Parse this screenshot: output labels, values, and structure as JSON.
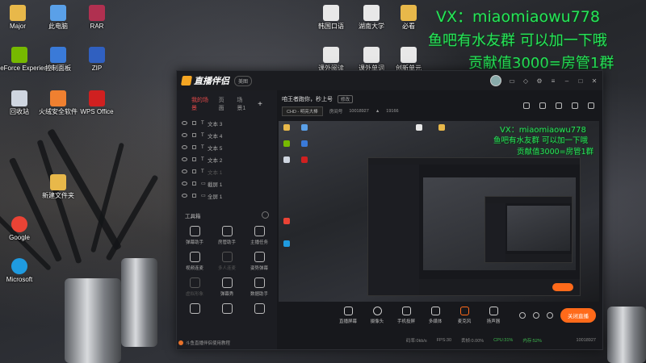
{
  "desktop": {
    "icons": [
      {
        "label": "Major",
        "color": "#e8b84a"
      },
      {
        "label": "此电脑",
        "color": "#5aa0e8"
      },
      {
        "label": "RAR",
        "color": "#b03050"
      },
      {
        "label": "GeForce Experience",
        "color": "#76b900"
      },
      {
        "label": "控制面板",
        "color": "#3a7ad8"
      },
      {
        "label": "ZIP",
        "color": "#3060c0"
      },
      {
        "label": "回收站",
        "color": "#cfd6e0"
      },
      {
        "label": "火绒安全软件",
        "color": "#f08030"
      },
      {
        "label": "WPS Office",
        "color": "#d02020"
      },
      {
        "label": "新建文件夹",
        "color": "#e8b84a"
      },
      {
        "label": "Google",
        "color": "#ea4335"
      },
      {
        "label": "Microsoft",
        "color": "#1f9be0"
      },
      {
        "label": "韩国口语",
        "color": "#e8e8e8"
      },
      {
        "label": "湖南大学",
        "color": "#e8e8e8"
      },
      {
        "label": "必看",
        "color": "#e8b84a"
      },
      {
        "label": "课外阅读",
        "color": "#e8e8e8"
      },
      {
        "label": "课外单词",
        "color": "#e8e8e8"
      },
      {
        "label": "创新单元",
        "color": "#e8e8e8"
      }
    ],
    "overlay_lines": [
      "VX：miaomiaowu778",
      "鱼吧有水友群 可以加一下哦",
      "贡献值3000=房管1群"
    ]
  },
  "app": {
    "name": "直播伴侣",
    "badge": "美图",
    "scene_tabs": [
      "我的场景",
      "页面",
      "场景1"
    ],
    "sources": [
      {
        "label": "文本 3",
        "type": "T",
        "dim": false
      },
      {
        "label": "文本 4",
        "type": "T",
        "dim": false
      },
      {
        "label": "文本 5",
        "type": "T",
        "dim": false
      },
      {
        "label": "文本 2",
        "type": "T",
        "dim": false
      },
      {
        "label": "文本 1",
        "type": "T",
        "dim": true
      },
      {
        "label": "截屏 1",
        "type": "▭",
        "dim": false
      },
      {
        "label": "全屏 1",
        "type": "▭",
        "dim": false
      }
    ],
    "tools_title": "工具箱",
    "tools": [
      {
        "label": "弹幕助手",
        "dim": false
      },
      {
        "label": "房管助手",
        "dim": false
      },
      {
        "label": "主播任务",
        "dim": false
      },
      {
        "label": "视频连麦",
        "dim": false
      },
      {
        "label": "多人连麦",
        "dim": true
      },
      {
        "label": "姿势弹幕",
        "dim": false
      },
      {
        "label": "虚拟形象",
        "dim": true
      },
      {
        "label": "弹幕秀",
        "dim": false
      },
      {
        "label": "数据助手",
        "dim": false
      },
      {
        "label": "",
        "dim": false
      },
      {
        "label": "",
        "dim": false
      },
      {
        "label": "",
        "dim": false
      }
    ],
    "notice": "斗鱼直播伴侣使用教程",
    "stream_title": "咱王者跑你，秒上号",
    "stream_tag": "修改",
    "quality": "CHD - 明亮大棒",
    "room_label": "房间号",
    "room_id": "10018927",
    "viewers": "19166",
    "bottom_tools": [
      "直播屏幕",
      "摄像头",
      "手机投屏",
      "多媒体",
      "麦克风",
      "扬声器"
    ],
    "go_live": "关闭直播",
    "status": {
      "bitrate": "码率:0kb/s",
      "fps": "FPS:30",
      "dropped": "丢帧:0.00%",
      "cpu": "CPU:31%",
      "mem": "内存:52%",
      "id": "10018927"
    }
  }
}
